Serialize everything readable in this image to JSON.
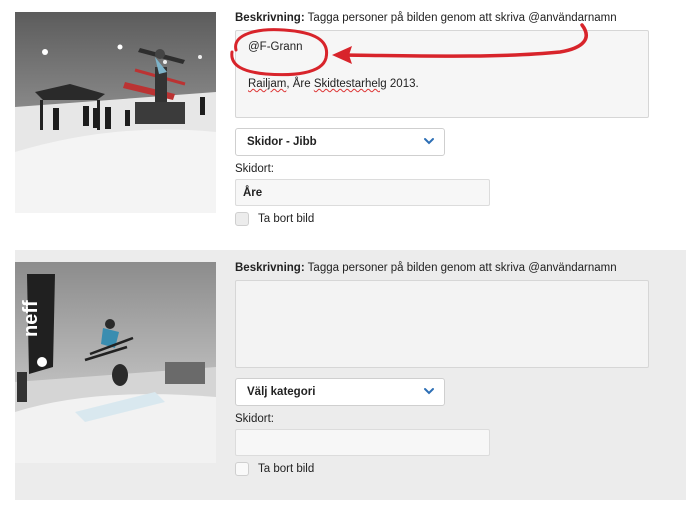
{
  "colors": {
    "annotation": "#d8242b",
    "accent": "#2d6fb5",
    "panel": "#ececec"
  },
  "items": [
    {
      "description_label": "Beskrivning:",
      "description_hint": "Tagga personer på bilden genom att skriva @användarnamn",
      "description_value_line1": "@F-Grann",
      "description_value_line2_a": "Railjam",
      "description_value_line2_b": ", Åre ",
      "description_value_line2_c": "Skidtestarhelg",
      "description_value_line2_d": " 2013.",
      "category_value": "Skidor - Jibb",
      "ski_resort_label": "Skidort:",
      "ski_resort_value": "Åre",
      "remove_label": "Ta bort bild",
      "photo_icon": "snowboard-rail-night-photo"
    },
    {
      "description_label": "Beskrivning:",
      "description_hint": "Tagga personer på bilden genom att skriva @användarnamn",
      "description_value_line1": "",
      "category_value": "Välj kategori",
      "ski_resort_label": "Skidort:",
      "ski_resort_value": "",
      "remove_label": "Ta bort bild",
      "photo_icon": "ski-jump-neff-photo",
      "banner_text": "neff"
    }
  ]
}
